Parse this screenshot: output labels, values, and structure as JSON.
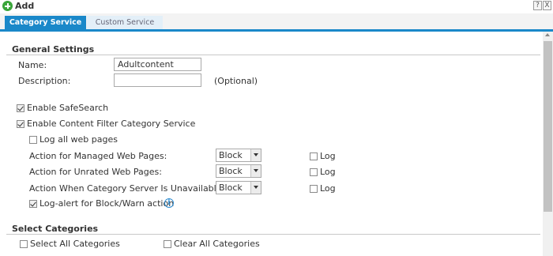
{
  "title": {
    "text": "Add",
    "icon": "add-circle-icon"
  },
  "window_controls": {
    "help": "?",
    "close": "X"
  },
  "tabs": [
    {
      "label": "Category Service",
      "active": true
    },
    {
      "label": "Custom Service",
      "active": false
    }
  ],
  "colors": {
    "accent": "#1a88c9",
    "add_icon": "#3aa53a"
  },
  "general": {
    "title": "General Settings",
    "name_label": "Name:",
    "name_value": "Adultcontent",
    "description_label": "Description:",
    "description_value": "",
    "optional_text": "(Optional)"
  },
  "options": {
    "safesearch": {
      "label": "Enable SafeSearch",
      "checked": true
    },
    "content_filter": {
      "label": "Enable Content Filter Category Service",
      "checked": true
    },
    "log_all": {
      "label": "Log all web pages",
      "checked": false
    },
    "actions": [
      {
        "label": "Action for Managed Web Pages:",
        "value": "Block",
        "log_label": "Log",
        "log_checked": false
      },
      {
        "label": "Action for Unrated Web Pages:",
        "value": "Block",
        "log_label": "Log",
        "log_checked": false
      },
      {
        "label": "Action When Category Server Is Unavailable:",
        "value": "Block",
        "log_label": "Log",
        "log_checked": false
      }
    ],
    "log_alert": {
      "label": "Log-alert for Block/Warn action",
      "checked": true,
      "info_icon": "i"
    }
  },
  "categories": {
    "title": "Select Categories",
    "select_all": {
      "label": "Select All Categories",
      "checked": false
    },
    "clear_all": {
      "label": "Clear All Categories",
      "checked": false
    }
  }
}
